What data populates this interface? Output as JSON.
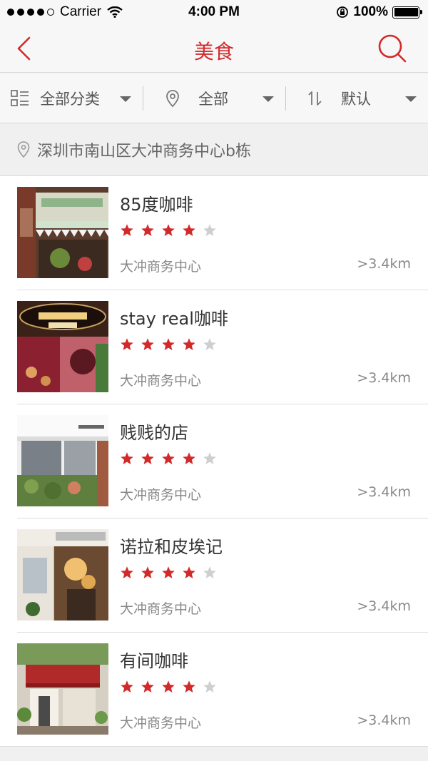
{
  "status": {
    "carrier": "Carrier",
    "time": "4:00 PM",
    "battery": "100%"
  },
  "nav": {
    "title": "美食",
    "back_icon": "chevron-left-icon",
    "search_icon": "search-icon"
  },
  "filters": [
    {
      "label": "全部分类",
      "icon": "category-grid-icon"
    },
    {
      "label": "全部",
      "icon": "location-pin-icon"
    },
    {
      "label": "默认",
      "icon": "sort-icon"
    }
  ],
  "location": {
    "text": "深圳市南山区大冲商务中心b栋"
  },
  "accent_color": "#d22a2a",
  "star_empty_color": "#cfcfcf",
  "items": [
    {
      "name": "85度咖啡",
      "rating": 4,
      "max_rating": 5,
      "area": "大冲商务中心",
      "distance": ">3.4km"
    },
    {
      "name": "stay real咖啡",
      "rating": 4,
      "max_rating": 5,
      "area": "大冲商务中心",
      "distance": ">3.4km"
    },
    {
      "name": "贱贱的店",
      "rating": 4,
      "max_rating": 5,
      "area": "大冲商务中心",
      "distance": ">3.4km"
    },
    {
      "name": "诺拉和皮埃记",
      "rating": 4,
      "max_rating": 5,
      "area": "大冲商务中心",
      "distance": ">3.4km"
    },
    {
      "name": "有间咖啡",
      "rating": 4,
      "max_rating": 5,
      "area": "大冲商务中心",
      "distance": ">3.4km"
    }
  ]
}
